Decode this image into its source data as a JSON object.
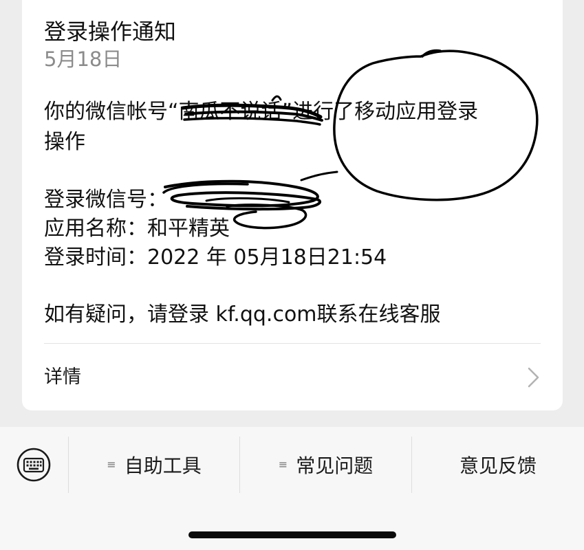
{
  "card": {
    "title": "登录操作通知",
    "date": "5月18日",
    "body": {
      "line1_prefix": "你的微信帐号",
      "line1_quoted_name": "“南瓜不说话”",
      "line1_suffix": "进行了移动应用登录",
      "line2": "操作"
    },
    "fields": {
      "account_label": "登录微信号：",
      "app_name_label": "应用名称：",
      "app_name_value": "和平精英",
      "login_time_label": "登录时间：",
      "login_time_value": "2022 年 05月18日21:54"
    },
    "help_text": "如有疑问，请登录 kf.qq.com联系在线客服",
    "details_label": "详情"
  },
  "bottom_menu": {
    "items": [
      {
        "label": "自助工具",
        "glyph": "≡"
      },
      {
        "label": "常见问题",
        "glyph": "≡"
      },
      {
        "label": "意见反馈",
        "glyph": ""
      }
    ]
  },
  "icons": {
    "keyboard": "keyboard-icon",
    "chevron": "chevron-right-icon",
    "menu": "menu-icon"
  }
}
